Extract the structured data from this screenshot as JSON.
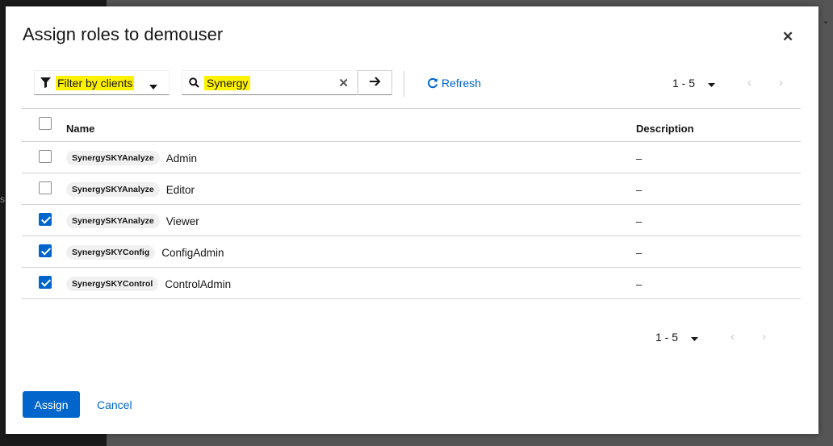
{
  "background": {
    "side_char": "s",
    "corner_char": "⌄"
  },
  "modal": {
    "title": "Assign roles to demouser",
    "close_glyph": "✕"
  },
  "toolbar": {
    "filter_label": "Filter by clients",
    "search_value": "Synergy",
    "clear_glyph": "✕",
    "refresh_label": "Refresh"
  },
  "pagination_top": {
    "range": "1 - 5",
    "prev": "‹",
    "next": "›"
  },
  "pagination_bottom": {
    "range": "1 - 5",
    "prev": "‹",
    "next": "›"
  },
  "table": {
    "columns": {
      "name": "Name",
      "description": "Description"
    },
    "rows": [
      {
        "client": "SynergySKYAnalyze",
        "role": "Admin",
        "description": "–",
        "checked": false
      },
      {
        "client": "SynergySKYAnalyze",
        "role": "Editor",
        "description": "–",
        "checked": false
      },
      {
        "client": "SynergySKYAnalyze",
        "role": "Viewer",
        "description": "–",
        "checked": true
      },
      {
        "client": "SynergySKYConfig",
        "role": "ConfigAdmin",
        "description": "–",
        "checked": true
      },
      {
        "client": "SynergySKYControl",
        "role": "ControlAdmin",
        "description": "–",
        "checked": true
      }
    ]
  },
  "footer": {
    "assign_label": "Assign",
    "cancel_label": "Cancel"
  },
  "colors": {
    "primary": "#0066cc",
    "highlight": "#fff200"
  },
  "icons": [
    "filter-icon",
    "caret-down-icon",
    "search-icon",
    "close-icon",
    "arrow-right-icon",
    "refresh-icon",
    "chevron-left-icon",
    "chevron-right-icon",
    "checkbox-icon"
  ]
}
